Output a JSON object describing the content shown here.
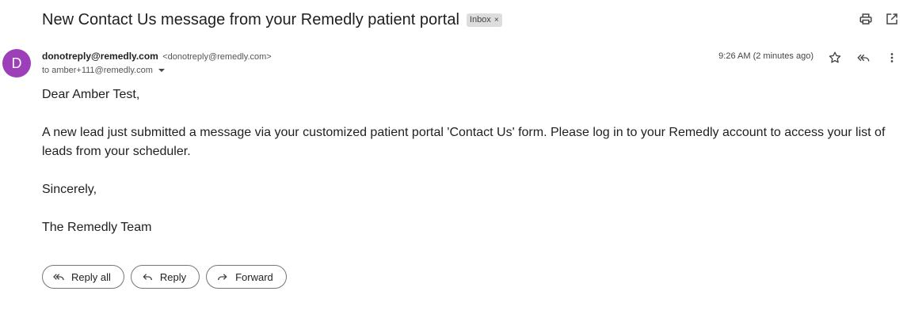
{
  "email": {
    "subject": "New Contact Us message from your Remedly patient portal",
    "label": "Inbox",
    "label_close": "×",
    "sender": {
      "avatar_letter": "D",
      "avatar_color": "#9c3fb8",
      "name": "donotreply@remedly.com",
      "email": "<donotreply@remedly.com>"
    },
    "recipient": "to amber+111@remedly.com",
    "time": "9:26 AM (2 minutes ago)",
    "body": {
      "greeting": "Dear Amber Test,",
      "paragraph": "A new lead just submitted a message via your customized patient portal 'Contact Us' form. Please log in to your Remedly account to access your list of leads from your scheduler.",
      "closing": "Sincerely,",
      "signature": "The Remedly Team"
    }
  },
  "actions": {
    "reply_all": "Reply all",
    "reply": "Reply",
    "forward": "Forward"
  },
  "icons": {
    "print": "print-icon",
    "open_new_window": "open-in-new-window-icon",
    "star": "star-icon",
    "reply": "reply-icon",
    "more": "more-vertical-icon",
    "caret": "chevron-down-icon",
    "reply_all": "reply-all-icon",
    "forward": "forward-icon"
  }
}
